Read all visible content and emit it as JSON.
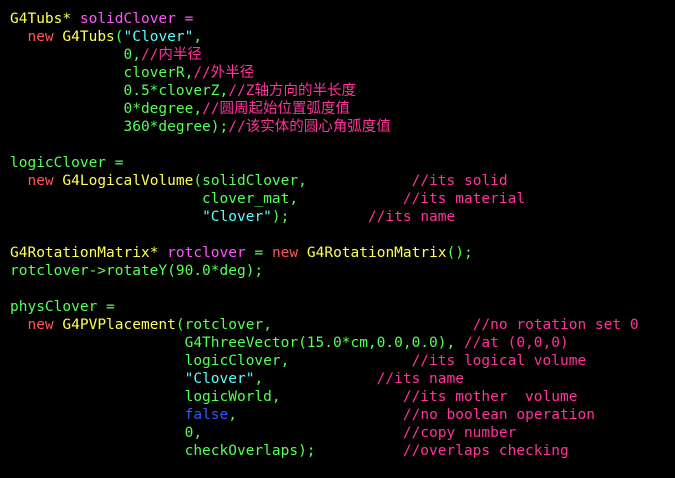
{
  "colors": {
    "background": "#000000",
    "type": "#ffff55",
    "keyword": "#ff5555",
    "identifier": "#ff55ff",
    "plain": "#55ff55",
    "string": "#55ffff",
    "comment": "#ff3399",
    "boolean": "#3355ff",
    "operator": "#ffff55"
  },
  "lines": [
    [
      [
        "type",
        "G4Tubs"
      ],
      [
        "operator",
        "*"
      ],
      [
        "identifier",
        " solidClover ="
      ]
    ],
    [
      [
        "plain",
        "  "
      ],
      [
        "keyword",
        "new"
      ],
      [
        "plain",
        " "
      ],
      [
        "type",
        "G4Tubs"
      ],
      [
        "plain",
        "("
      ],
      [
        "string",
        "\"Clover\""
      ],
      [
        "plain",
        ","
      ]
    ],
    [
      [
        "plain",
        "             0,"
      ],
      [
        "comment",
        "//内半径"
      ]
    ],
    [
      [
        "plain",
        "             cloverR,"
      ],
      [
        "comment",
        "//外半径"
      ]
    ],
    [
      [
        "plain",
        "             0.5*cloverZ,"
      ],
      [
        "comment",
        "//Z轴方向的半长度"
      ]
    ],
    [
      [
        "plain",
        "             0*degree,"
      ],
      [
        "comment",
        "//圆周起始位置弧度值"
      ]
    ],
    [
      [
        "plain",
        "             360*degree);"
      ],
      [
        "comment",
        "//该实体的圆心角弧度值"
      ]
    ],
    [],
    [
      [
        "plain",
        "logicClover ="
      ]
    ],
    [
      [
        "plain",
        "  "
      ],
      [
        "keyword",
        "new"
      ],
      [
        "plain",
        " "
      ],
      [
        "type",
        "G4LogicalVolume"
      ],
      [
        "plain",
        "(solidClover,            "
      ],
      [
        "comment",
        "//its solid"
      ]
    ],
    [
      [
        "plain",
        "                      clover_mat,            "
      ],
      [
        "comment",
        "//its material"
      ]
    ],
    [
      [
        "plain",
        "                      "
      ],
      [
        "string",
        "\"Clover\""
      ],
      [
        "plain",
        ");         "
      ],
      [
        "comment",
        "//its name"
      ]
    ],
    [],
    [
      [
        "type",
        "G4RotationMatrix"
      ],
      [
        "operator",
        "*"
      ],
      [
        "identifier",
        " rotclover"
      ],
      [
        "plain",
        " = "
      ],
      [
        "keyword",
        "new"
      ],
      [
        "plain",
        " "
      ],
      [
        "type",
        "G4RotationMatrix"
      ],
      [
        "plain",
        "();"
      ]
    ],
    [
      [
        "plain",
        "rotclover->rotateY(90.0*deg);"
      ]
    ],
    [],
    [
      [
        "plain",
        "physClover ="
      ]
    ],
    [
      [
        "plain",
        "  "
      ],
      [
        "keyword",
        "new"
      ],
      [
        "plain",
        " "
      ],
      [
        "type",
        "G4PVPlacement"
      ],
      [
        "plain",
        "(rotclover,                       "
      ],
      [
        "comment",
        "//no rotation set 0"
      ]
    ],
    [
      [
        "plain",
        "                    G4ThreeVector(15.0*cm,0.0,0.0), "
      ],
      [
        "comment",
        "//at (0,0,0)"
      ]
    ],
    [
      [
        "plain",
        "                    logicClover,              "
      ],
      [
        "comment",
        "//its logical volume"
      ]
    ],
    [
      [
        "plain",
        "                    "
      ],
      [
        "string",
        "\"Clover\""
      ],
      [
        "plain",
        ",             "
      ],
      [
        "comment",
        "//its name"
      ]
    ],
    [
      [
        "plain",
        "                    logicWorld,              "
      ],
      [
        "comment",
        "//its mother  volume"
      ]
    ],
    [
      [
        "plain",
        "                    "
      ],
      [
        "boolean",
        "false"
      ],
      [
        "plain",
        ",                   "
      ],
      [
        "comment",
        "//no boolean operation"
      ]
    ],
    [
      [
        "plain",
        "                    0,                       "
      ],
      [
        "comment",
        "//copy number"
      ]
    ],
    [
      [
        "plain",
        "                    checkOverlaps);          "
      ],
      [
        "comment",
        "//overlaps checking"
      ]
    ]
  ]
}
